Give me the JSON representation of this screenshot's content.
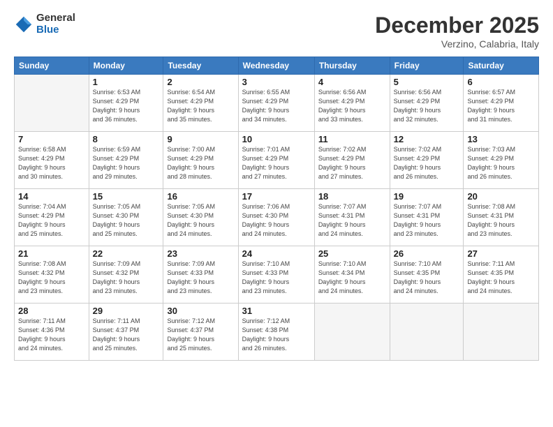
{
  "header": {
    "logo_general": "General",
    "logo_blue": "Blue",
    "month_title": "December 2025",
    "subtitle": "Verzino, Calabria, Italy"
  },
  "days_of_week": [
    "Sunday",
    "Monday",
    "Tuesday",
    "Wednesday",
    "Thursday",
    "Friday",
    "Saturday"
  ],
  "weeks": [
    [
      {
        "day": "",
        "info": ""
      },
      {
        "day": "1",
        "info": "Sunrise: 6:53 AM\nSunset: 4:29 PM\nDaylight: 9 hours\nand 36 minutes."
      },
      {
        "day": "2",
        "info": "Sunrise: 6:54 AM\nSunset: 4:29 PM\nDaylight: 9 hours\nand 35 minutes."
      },
      {
        "day": "3",
        "info": "Sunrise: 6:55 AM\nSunset: 4:29 PM\nDaylight: 9 hours\nand 34 minutes."
      },
      {
        "day": "4",
        "info": "Sunrise: 6:56 AM\nSunset: 4:29 PM\nDaylight: 9 hours\nand 33 minutes."
      },
      {
        "day": "5",
        "info": "Sunrise: 6:56 AM\nSunset: 4:29 PM\nDaylight: 9 hours\nand 32 minutes."
      },
      {
        "day": "6",
        "info": "Sunrise: 6:57 AM\nSunset: 4:29 PM\nDaylight: 9 hours\nand 31 minutes."
      }
    ],
    [
      {
        "day": "7",
        "info": "Sunrise: 6:58 AM\nSunset: 4:29 PM\nDaylight: 9 hours\nand 30 minutes."
      },
      {
        "day": "8",
        "info": "Sunrise: 6:59 AM\nSunset: 4:29 PM\nDaylight: 9 hours\nand 29 minutes."
      },
      {
        "day": "9",
        "info": "Sunrise: 7:00 AM\nSunset: 4:29 PM\nDaylight: 9 hours\nand 28 minutes."
      },
      {
        "day": "10",
        "info": "Sunrise: 7:01 AM\nSunset: 4:29 PM\nDaylight: 9 hours\nand 27 minutes."
      },
      {
        "day": "11",
        "info": "Sunrise: 7:02 AM\nSunset: 4:29 PM\nDaylight: 9 hours\nand 27 minutes."
      },
      {
        "day": "12",
        "info": "Sunrise: 7:02 AM\nSunset: 4:29 PM\nDaylight: 9 hours\nand 26 minutes."
      },
      {
        "day": "13",
        "info": "Sunrise: 7:03 AM\nSunset: 4:29 PM\nDaylight: 9 hours\nand 26 minutes."
      }
    ],
    [
      {
        "day": "14",
        "info": "Sunrise: 7:04 AM\nSunset: 4:29 PM\nDaylight: 9 hours\nand 25 minutes."
      },
      {
        "day": "15",
        "info": "Sunrise: 7:05 AM\nSunset: 4:30 PM\nDaylight: 9 hours\nand 25 minutes."
      },
      {
        "day": "16",
        "info": "Sunrise: 7:05 AM\nSunset: 4:30 PM\nDaylight: 9 hours\nand 24 minutes."
      },
      {
        "day": "17",
        "info": "Sunrise: 7:06 AM\nSunset: 4:30 PM\nDaylight: 9 hours\nand 24 minutes."
      },
      {
        "day": "18",
        "info": "Sunrise: 7:07 AM\nSunset: 4:31 PM\nDaylight: 9 hours\nand 24 minutes."
      },
      {
        "day": "19",
        "info": "Sunrise: 7:07 AM\nSunset: 4:31 PM\nDaylight: 9 hours\nand 23 minutes."
      },
      {
        "day": "20",
        "info": "Sunrise: 7:08 AM\nSunset: 4:31 PM\nDaylight: 9 hours\nand 23 minutes."
      }
    ],
    [
      {
        "day": "21",
        "info": "Sunrise: 7:08 AM\nSunset: 4:32 PM\nDaylight: 9 hours\nand 23 minutes."
      },
      {
        "day": "22",
        "info": "Sunrise: 7:09 AM\nSunset: 4:32 PM\nDaylight: 9 hours\nand 23 minutes."
      },
      {
        "day": "23",
        "info": "Sunrise: 7:09 AM\nSunset: 4:33 PM\nDaylight: 9 hours\nand 23 minutes."
      },
      {
        "day": "24",
        "info": "Sunrise: 7:10 AM\nSunset: 4:33 PM\nDaylight: 9 hours\nand 23 minutes."
      },
      {
        "day": "25",
        "info": "Sunrise: 7:10 AM\nSunset: 4:34 PM\nDaylight: 9 hours\nand 24 minutes."
      },
      {
        "day": "26",
        "info": "Sunrise: 7:10 AM\nSunset: 4:35 PM\nDaylight: 9 hours\nand 24 minutes."
      },
      {
        "day": "27",
        "info": "Sunrise: 7:11 AM\nSunset: 4:35 PM\nDaylight: 9 hours\nand 24 minutes."
      }
    ],
    [
      {
        "day": "28",
        "info": "Sunrise: 7:11 AM\nSunset: 4:36 PM\nDaylight: 9 hours\nand 24 minutes."
      },
      {
        "day": "29",
        "info": "Sunrise: 7:11 AM\nSunset: 4:37 PM\nDaylight: 9 hours\nand 25 minutes."
      },
      {
        "day": "30",
        "info": "Sunrise: 7:12 AM\nSunset: 4:37 PM\nDaylight: 9 hours\nand 25 minutes."
      },
      {
        "day": "31",
        "info": "Sunrise: 7:12 AM\nSunset: 4:38 PM\nDaylight: 9 hours\nand 26 minutes."
      },
      {
        "day": "",
        "info": ""
      },
      {
        "day": "",
        "info": ""
      },
      {
        "day": "",
        "info": ""
      }
    ]
  ]
}
